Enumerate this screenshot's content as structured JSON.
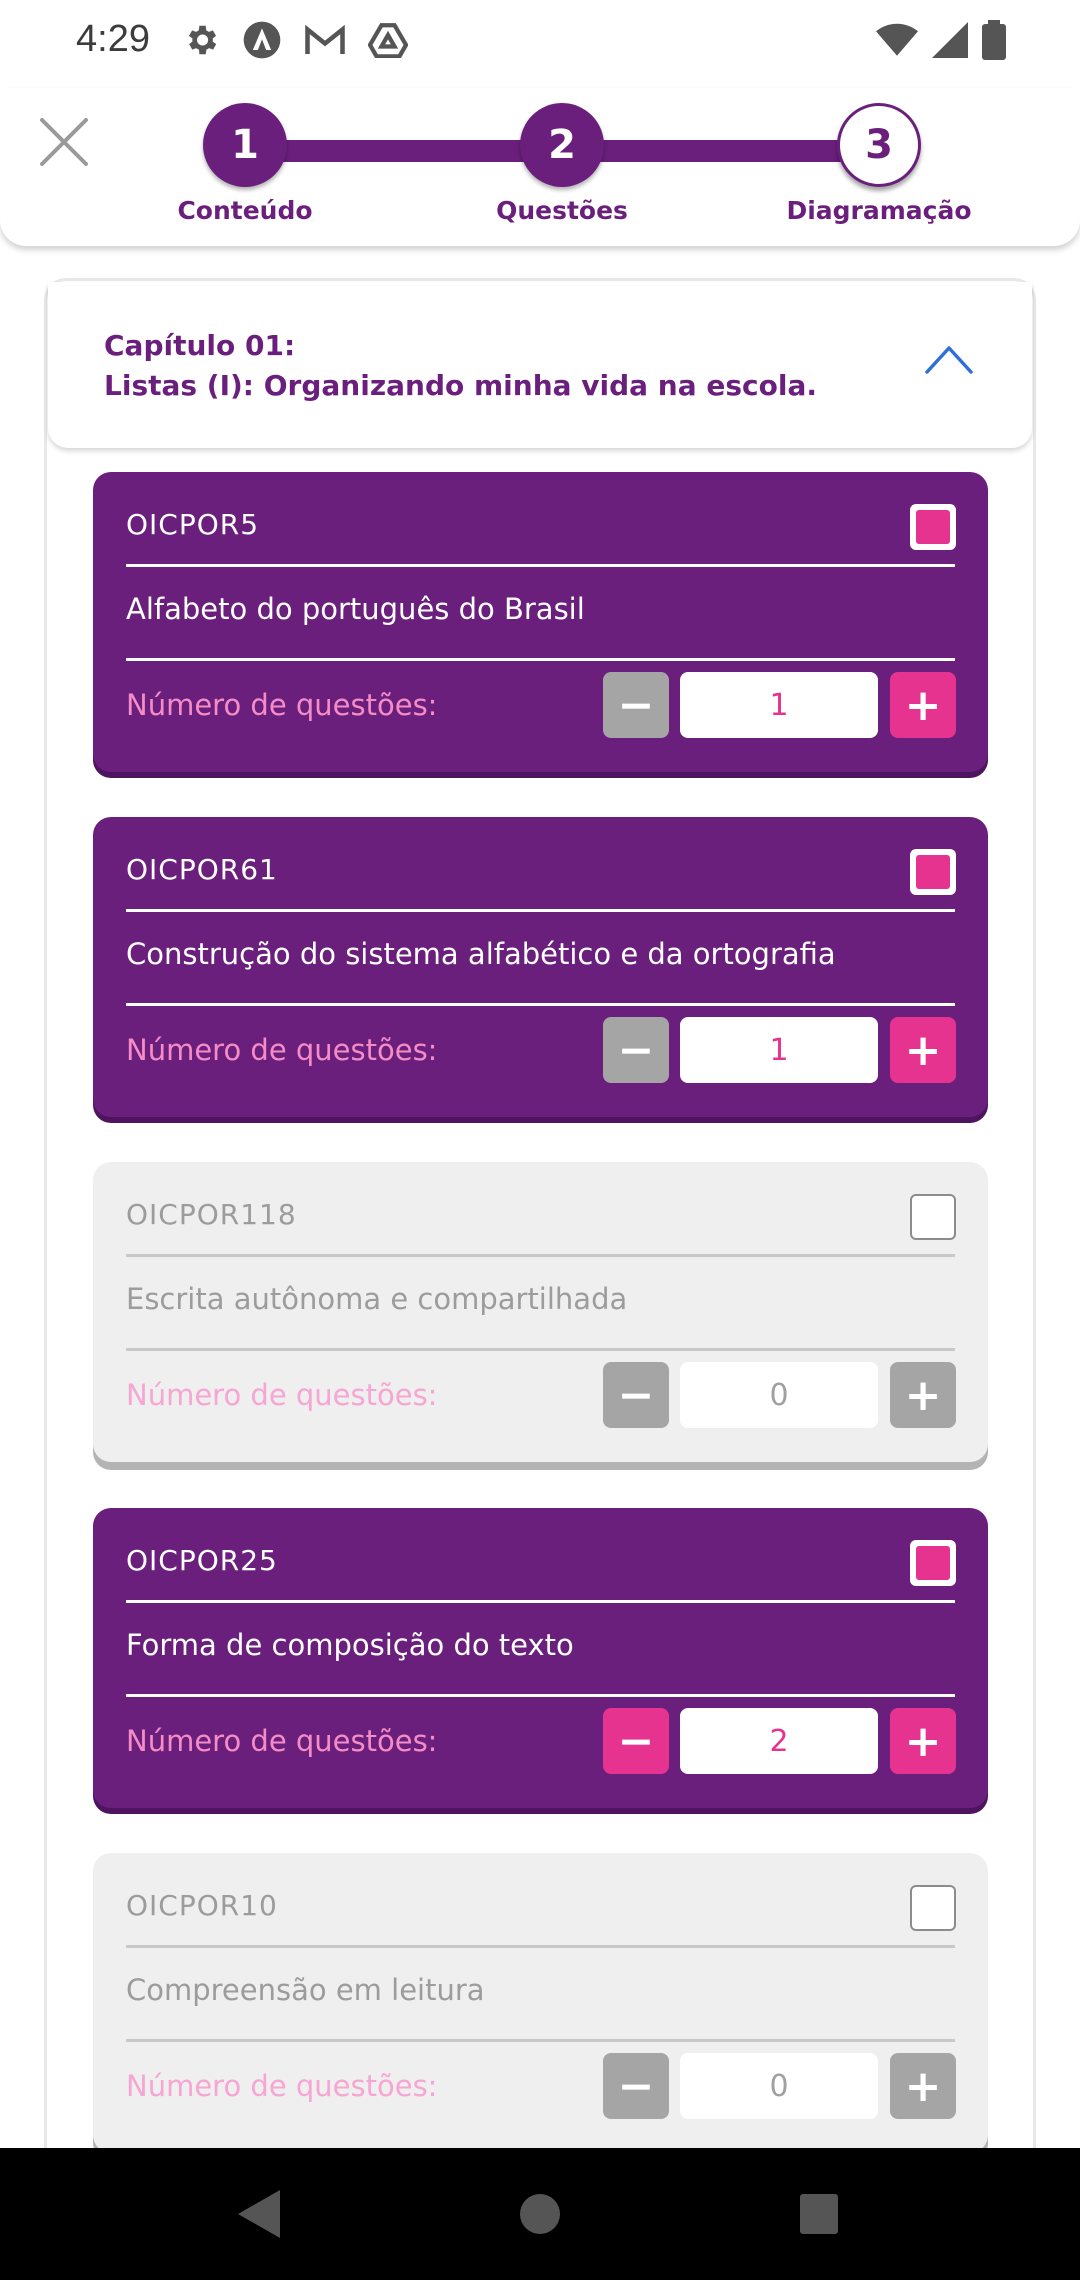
{
  "status_bar": {
    "time": "4:29",
    "left_icons": [
      "settings-icon",
      "app-a-icon",
      "gmail-icon",
      "drive-icon"
    ],
    "right_icons": [
      "wifi-icon",
      "signal-icon",
      "battery-icon"
    ]
  },
  "stepper": {
    "steps": [
      {
        "number": "1",
        "label": "Conteúdo",
        "state": "done"
      },
      {
        "number": "2",
        "label": "Questões",
        "state": "done"
      },
      {
        "number": "3",
        "label": "Diagramação",
        "state": "current"
      }
    ]
  },
  "chapter": {
    "line1": "Capítulo 01:",
    "line2": "Listas (I): Organizando minha vida na escola."
  },
  "topics": [
    {
      "code": "OICPOR5",
      "name": "Alfabeto do português do Brasil",
      "qty_label": "Número de questões:",
      "qty": "1",
      "selected": true
    },
    {
      "code": "OICPOR61",
      "name": "Construção do sistema alfabético e da ortografia",
      "qty_label": "Número de questões:",
      "qty": "1",
      "selected": true
    },
    {
      "code": "OICPOR118",
      "name": "Escrita autônoma e compartilhada",
      "qty_label": "Número de questões:",
      "qty": "0",
      "selected": false
    },
    {
      "code": "OICPOR25",
      "name": "Forma de composição do texto",
      "qty_label": "Número de questões:",
      "qty": "2",
      "selected": true
    },
    {
      "code": "OICPOR10",
      "name": "Compreensão em leitura",
      "qty_label": "Número de questões:",
      "qty": "0",
      "selected": false
    }
  ],
  "colors": {
    "primary": "#6b1f7d",
    "accent": "#e5338f",
    "disabled": "#a5a5a5",
    "card_off": "#efefef"
  }
}
